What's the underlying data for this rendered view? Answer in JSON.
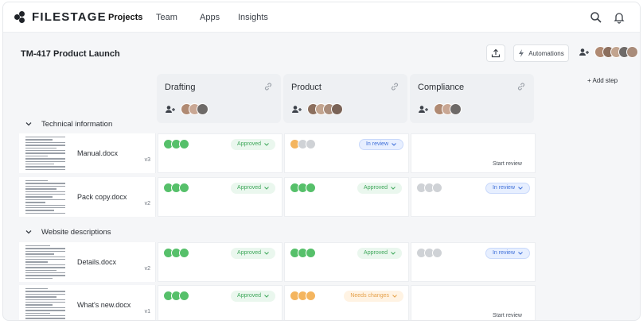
{
  "nav": {
    "brand": "FILESTAGE",
    "items": [
      {
        "label": "Projects",
        "active": true
      },
      {
        "label": "Team",
        "active": false
      },
      {
        "label": "Apps",
        "active": false
      },
      {
        "label": "Insights",
        "active": false
      }
    ],
    "icons": [
      "search-icon",
      "bell-icon"
    ]
  },
  "project": {
    "title": "TM-417 Product Launch",
    "automations_label": "Automations",
    "add_step_label": "+ Add step"
  },
  "steps": [
    {
      "name": "Drafting"
    },
    {
      "name": "Product"
    },
    {
      "name": "Compliance"
    }
  ],
  "groups": [
    {
      "name": "Technical information"
    },
    {
      "name": "Website descriptions"
    }
  ],
  "files": [
    {
      "name": "Manual.docx",
      "version": "v3"
    },
    {
      "name": "Pack copy.docx",
      "version": "v2"
    },
    {
      "name": "Details.docx",
      "version": "v2"
    },
    {
      "name": "What's new.docx",
      "version": "v1"
    }
  ],
  "status_labels": {
    "approved": "Approved",
    "in_review": "In review",
    "needs_changes": "Needs changes",
    "start_review": "Start review"
  },
  "colors": {
    "approved": "#56c06a",
    "pending": "#cfd2d6",
    "changes": "#f4b55f",
    "review": "#3e6fd8"
  }
}
